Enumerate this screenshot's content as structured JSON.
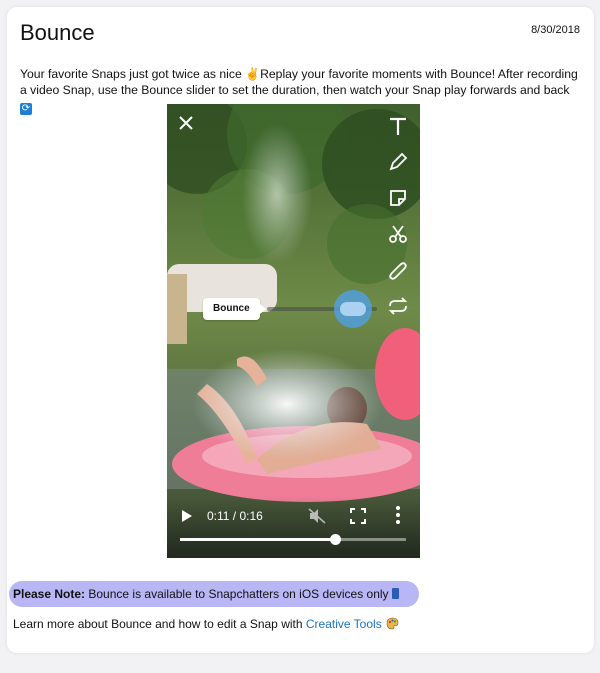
{
  "article": {
    "title": "Bounce",
    "date": "8/30/2018",
    "description_part1": "Your favorite Snaps just got twice as nice ",
    "wave_emoji": "✌",
    "description_part2": "Replay your favorite moments with Bounce! After recording a video Snap, use the Bounce slider to set the duration, then watch your Snap play forwards and back ",
    "repeat_emoji": "🔁"
  },
  "video": {
    "bounce_label": "Bounce",
    "current_time": "0:11",
    "duration": "0:16",
    "time_display": "0:11 / 0:16",
    "progress_fraction": 0.6875,
    "bounce_slider_fraction": 0.78,
    "icons": [
      "close-icon",
      "text-icon",
      "pencil-icon",
      "sticker-icon",
      "scissors-icon",
      "paperclip-icon",
      "bounce-icon",
      "play-icon",
      "mute-icon",
      "fullscreen-icon",
      "more-icon"
    ]
  },
  "note": {
    "label": "Please Note:",
    "text": " Bounce is available to Snapchatters on iOS devices only",
    "highlight_color": "#b9b6f6"
  },
  "learn_more": {
    "text": "Learn more about Bounce and how to edit a Snap with ",
    "link_text": "Creative Tools",
    "link_color": "#1a73c8"
  }
}
